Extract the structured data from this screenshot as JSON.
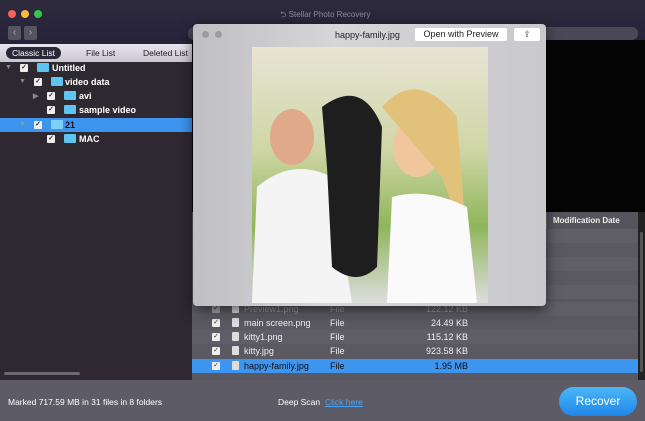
{
  "app": {
    "title": "Stellar Photo Recovery"
  },
  "colors": {
    "accent": "#3d95f0",
    "folder": "#5ec4f1",
    "link": "#4aa3f5"
  },
  "sidebar": {
    "tabs": [
      "Classic List",
      "File List",
      "Deleted List"
    ],
    "tree": [
      {
        "label": "Untitled",
        "expanded": true,
        "checked": true
      },
      {
        "label": "video data",
        "expanded": true,
        "checked": true
      },
      {
        "label": "avi",
        "expanded": false,
        "checked": true
      },
      {
        "label": "sample video",
        "checked": true
      },
      {
        "label": "21",
        "expanded": true,
        "checked": true,
        "selected": true
      },
      {
        "label": "MAC",
        "checked": true
      }
    ]
  },
  "table": {
    "columns": {
      "modified": "Modification Date"
    },
    "rows": [
      {
        "name": "Preview1.png",
        "kind": "File",
        "size": "122.12 KB"
      },
      {
        "name": "main screen.png",
        "kind": "File",
        "size": "24.49 KB"
      },
      {
        "name": "kitty1.png",
        "kind": "File",
        "size": "115.12 KB"
      },
      {
        "name": "kitty.jpg",
        "kind": "File",
        "size": "923.58 KB"
      },
      {
        "name": "happy-family.jpg",
        "kind": "File",
        "size": "1.95 MB",
        "selected": true
      }
    ]
  },
  "preview": {
    "title": "happy-family.jpg",
    "open_label": "Open with Preview",
    "share_icon": "share-icon"
  },
  "footer": {
    "status": "Marked 717.59 MB in 31 files in 8 folders",
    "deep_scan": "Deep Scan",
    "click_here": "Click here",
    "recover": "Recover"
  }
}
